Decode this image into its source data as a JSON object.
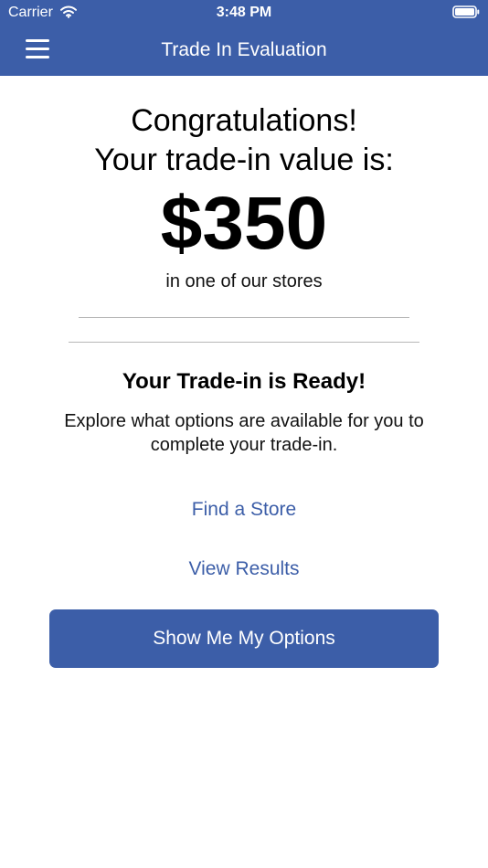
{
  "status_bar": {
    "carrier": "Carrier",
    "time": "3:48 PM",
    "icons": [
      "wifi-icon",
      "battery-icon"
    ]
  },
  "header": {
    "title": "Trade In Evaluation",
    "menu_icon": "menu-icon"
  },
  "result": {
    "headline_line1": "Congratulations!",
    "headline_line2": "Your trade-in value is:",
    "amount": "$350",
    "location_note": "in one of our stores"
  },
  "ready": {
    "title": "Your Trade-in is Ready!",
    "description": "Explore what options are available for you to complete your trade-in."
  },
  "actions": {
    "find_store_label": "Find a Store",
    "view_results_label": "View Results",
    "primary_label": "Show Me My Options"
  },
  "colors": {
    "brand_blue": "#3c5ea8",
    "background": "#ffffff",
    "divider": "#b8b8b8"
  }
}
